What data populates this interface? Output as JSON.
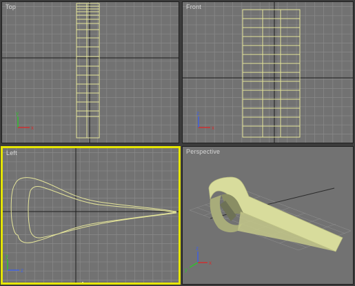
{
  "viewports": {
    "top": {
      "label": "Top"
    },
    "front": {
      "label": "Front"
    },
    "left": {
      "label": "Left"
    },
    "perspective": {
      "label": "Perspective"
    }
  },
  "axes": {
    "x": "x",
    "y": "y",
    "z": "z"
  },
  "colors": {
    "viewport_bg": "#727272",
    "grid_line": "#8a8a8a",
    "home_grid_axis": "#1c1c1c",
    "wireframe": "#e6e69a",
    "active_border": "#e6e600",
    "axis_x": "#d03030",
    "axis_y": "#30c030",
    "axis_z": "#4060e0",
    "surface": "#d8dc9c"
  }
}
